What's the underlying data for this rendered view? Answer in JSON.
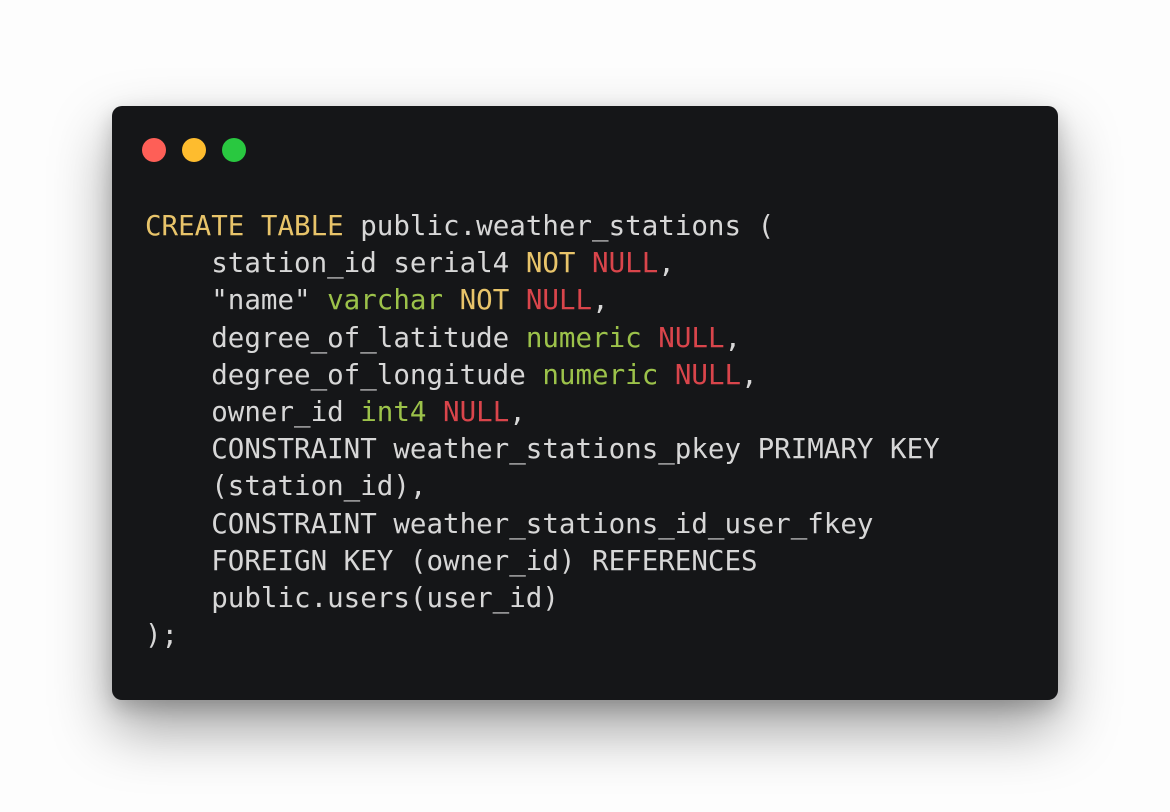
{
  "colors": {
    "background": "#fdfdfd",
    "window": "#151618",
    "plain": "#d7d7d7",
    "keyword": "#e8c46a",
    "type": "#9cc24a",
    "null": "#d9454b",
    "light_red": "#fe5f57",
    "light_yellow": "#febc2e",
    "light_green": "#29c840"
  },
  "window_controls": [
    {
      "name": "close-light",
      "color": "light_red"
    },
    {
      "name": "minimize-light",
      "color": "light_yellow"
    },
    {
      "name": "maximize-light",
      "color": "light_green"
    }
  ],
  "code_lines": [
    [
      {
        "t": "CREATE TABLE",
        "c": "keyword"
      },
      {
        "t": " public.weather_stations (",
        "c": "plain"
      }
    ],
    [
      {
        "t": "    station_id serial4 ",
        "c": "plain"
      },
      {
        "t": "NOT",
        "c": "keyword"
      },
      {
        "t": " ",
        "c": "plain"
      },
      {
        "t": "NULL",
        "c": "null"
      },
      {
        "t": ",",
        "c": "plain"
      }
    ],
    [
      {
        "t": "    \"name\" ",
        "c": "plain"
      },
      {
        "t": "varchar",
        "c": "type"
      },
      {
        "t": " ",
        "c": "plain"
      },
      {
        "t": "NOT",
        "c": "keyword"
      },
      {
        "t": " ",
        "c": "plain"
      },
      {
        "t": "NULL",
        "c": "null"
      },
      {
        "t": ",",
        "c": "plain"
      }
    ],
    [
      {
        "t": "    degree_of_latitude ",
        "c": "plain"
      },
      {
        "t": "numeric",
        "c": "type"
      },
      {
        "t": " ",
        "c": "plain"
      },
      {
        "t": "NULL",
        "c": "null"
      },
      {
        "t": ",",
        "c": "plain"
      }
    ],
    [
      {
        "t": "    degree_of_longitude ",
        "c": "plain"
      },
      {
        "t": "numeric",
        "c": "type"
      },
      {
        "t": " ",
        "c": "plain"
      },
      {
        "t": "NULL",
        "c": "null"
      },
      {
        "t": ",",
        "c": "plain"
      }
    ],
    [
      {
        "t": "    owner_id ",
        "c": "plain"
      },
      {
        "t": "int4",
        "c": "type"
      },
      {
        "t": " ",
        "c": "plain"
      },
      {
        "t": "NULL",
        "c": "null"
      },
      {
        "t": ",",
        "c": "plain"
      }
    ],
    [
      {
        "t": "    CONSTRAINT weather_stations_pkey PRIMARY KEY",
        "c": "plain"
      }
    ],
    [
      {
        "t": "    (station_id),",
        "c": "plain"
      }
    ],
    [
      {
        "t": "    CONSTRAINT weather_stations_id_user_fkey",
        "c": "plain"
      }
    ],
    [
      {
        "t": "    FOREIGN KEY (owner_id) REFERENCES",
        "c": "plain"
      }
    ],
    [
      {
        "t": "    public.users(user_id)",
        "c": "plain"
      }
    ],
    [
      {
        "t": ");",
        "c": "plain"
      }
    ]
  ]
}
